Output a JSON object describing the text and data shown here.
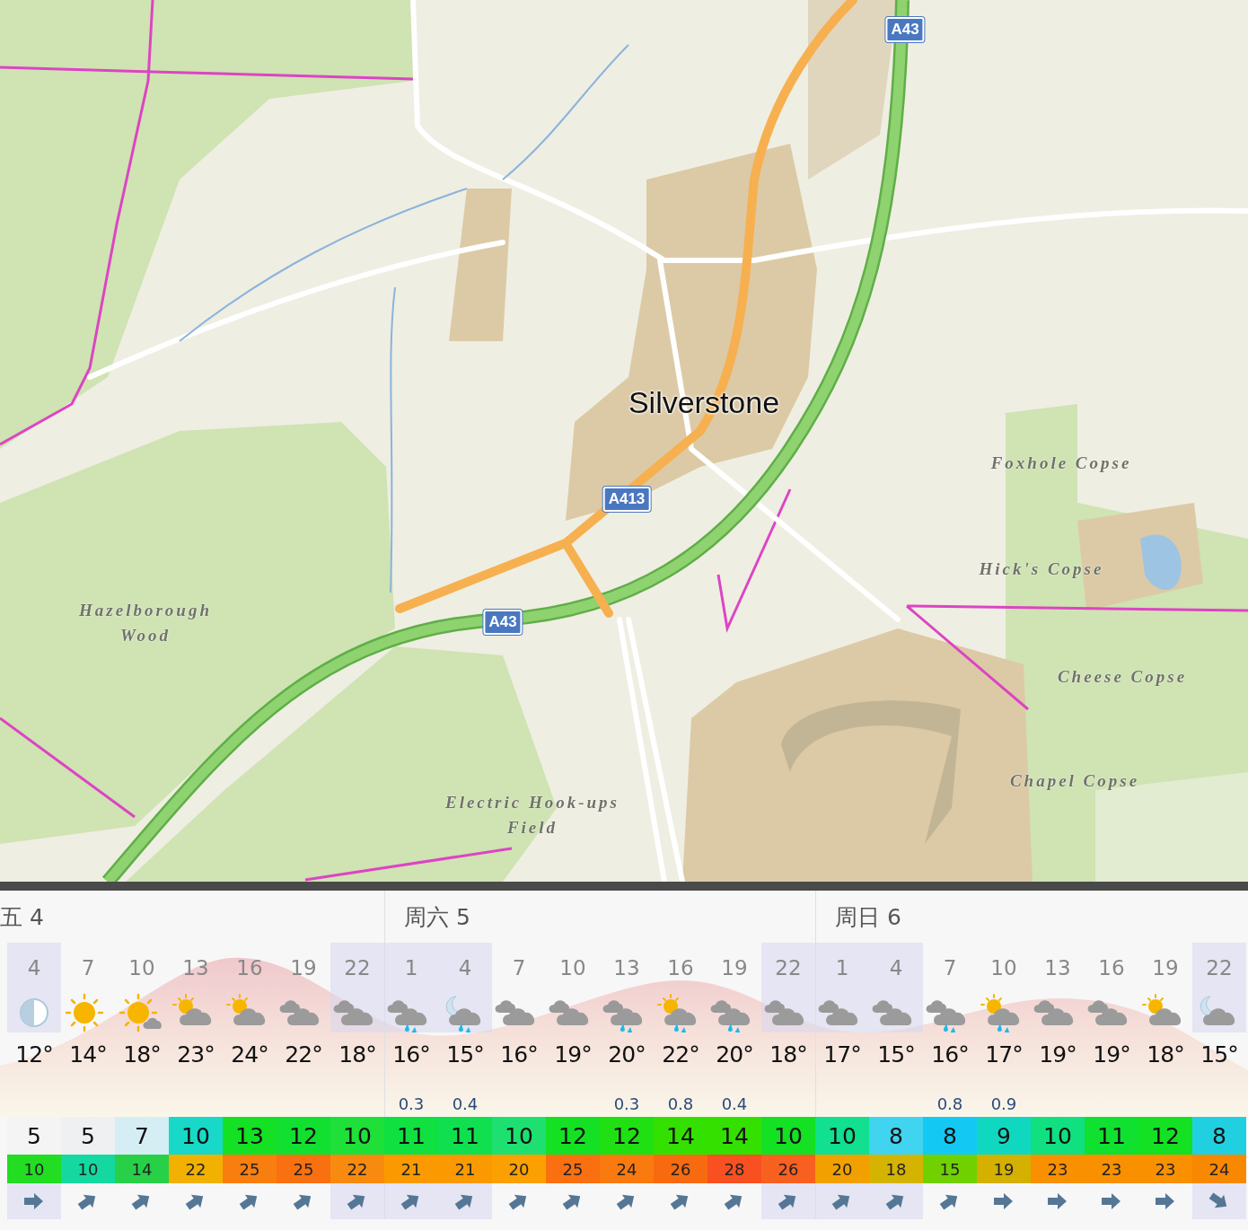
{
  "map": {
    "labels": [
      {
        "text": "A43",
        "kind": "road"
      },
      {
        "text": "Silverstone",
        "kind": "town"
      },
      {
        "text": "A413",
        "kind": "road"
      },
      {
        "text": "Foxhole Copse",
        "kind": "area"
      },
      {
        "text": "Hick's Copse",
        "kind": "area"
      },
      {
        "text": "Hazelborough Wood",
        "kind": "area"
      },
      {
        "text": "A43",
        "kind": "road"
      },
      {
        "text": "Cheese Copse",
        "kind": "area"
      },
      {
        "text": "Chapel Copse",
        "kind": "area"
      },
      {
        "text": "Electric Hook-ups Field",
        "kind": "area"
      }
    ]
  },
  "forecast": {
    "days": [
      {
        "label": "五 4",
        "hours": [
          {
            "hour": "4",
            "night": true,
            "kind": "half-moon",
            "temp": "12°"
          },
          {
            "hour": "7",
            "night": false,
            "kind": "sun",
            "temp": "14°"
          },
          {
            "hour": "10",
            "night": false,
            "kind": "sun-small-cloud",
            "temp": "18°"
          },
          {
            "hour": "13",
            "night": false,
            "kind": "partly-cloudy",
            "temp": "23°"
          },
          {
            "hour": "16",
            "night": false,
            "kind": "partly-cloudy",
            "temp": "24°"
          },
          {
            "hour": "19",
            "night": false,
            "kind": "cloudy",
            "temp": "22°"
          },
          {
            "hour": "22",
            "night": true,
            "kind": "cloudy",
            "temp": "18°"
          }
        ],
        "wind_speeds": [
          {
            "value": "5",
            "color": "#f4f4f4"
          },
          {
            "value": "5",
            "color": "#eef0f2"
          },
          {
            "value": "7",
            "color": "#d4eef4"
          },
          {
            "value": "10",
            "color": "#18d8c8"
          },
          {
            "value": "13",
            "color": "#14e024"
          },
          {
            "value": "12",
            "color": "#12e030"
          },
          {
            "value": "10",
            "color": "#1ee038"
          }
        ],
        "gusts": [
          {
            "value": "10",
            "color": "#22dd22"
          },
          {
            "value": "10",
            "color": "#14d8a0"
          },
          {
            "value": "14",
            "color": "#28d048"
          },
          {
            "value": "22",
            "color": "#f2b000"
          },
          {
            "value": "25",
            "color": "#f87e10"
          },
          {
            "value": "25",
            "color": "#f87010"
          },
          {
            "value": "22",
            "color": "#f88a10"
          }
        ],
        "wind_directions": [
          {
            "kind": "east"
          },
          {
            "kind": "northeast"
          },
          {
            "kind": "northeast"
          },
          {
            "kind": "northeast"
          },
          {
            "kind": "northeast"
          },
          {
            "kind": "northeast"
          },
          {
            "kind": "northeast"
          }
        ]
      },
      {
        "label": "周六 5",
        "hours": [
          {
            "hour": "1",
            "night": true,
            "kind": "rain",
            "temp": "16°",
            "precip": "0.3"
          },
          {
            "hour": "4",
            "night": true,
            "kind": "moon-rain",
            "temp": "15°",
            "precip": "0.4"
          },
          {
            "hour": "7",
            "night": false,
            "kind": "cloudy",
            "temp": "16°"
          },
          {
            "hour": "10",
            "night": false,
            "kind": "cloudy",
            "temp": "19°"
          },
          {
            "hour": "13",
            "night": false,
            "kind": "rain",
            "temp": "20°",
            "precip": "0.3"
          },
          {
            "hour": "16",
            "night": false,
            "kind": "sun-rain",
            "temp": "22°",
            "precip": "0.8"
          },
          {
            "hour": "19",
            "night": false,
            "kind": "rain",
            "temp": "20°",
            "precip": "0.4"
          },
          {
            "hour": "22",
            "night": true,
            "kind": "cloudy",
            "temp": "18°"
          }
        ],
        "wind_speeds": [
          {
            "value": "11",
            "color": "#10e040"
          },
          {
            "value": "11",
            "color": "#10e050"
          },
          {
            "value": "10",
            "color": "#1ee070"
          },
          {
            "value": "12",
            "color": "#14e024"
          },
          {
            "value": "12",
            "color": "#20e014"
          },
          {
            "value": "14",
            "color": "#34e000"
          },
          {
            "value": "14",
            "color": "#34e000"
          },
          {
            "value": "10",
            "color": "#14e024"
          }
        ],
        "gusts": [
          {
            "value": "21",
            "color": "#fa9a00"
          },
          {
            "value": "21",
            "color": "#fa9a00"
          },
          {
            "value": "20",
            "color": "#fba000"
          },
          {
            "value": "25",
            "color": "#fa7010"
          },
          {
            "value": "24",
            "color": "#fa7a10"
          },
          {
            "value": "26",
            "color": "#f86a10"
          },
          {
            "value": "28",
            "color": "#f85020"
          },
          {
            "value": "26",
            "color": "#f86020"
          }
        ],
        "wind_directions": [
          {
            "kind": "northeast"
          },
          {
            "kind": "northeast"
          },
          {
            "kind": "northeast"
          },
          {
            "kind": "northeast"
          },
          {
            "kind": "northeast"
          },
          {
            "kind": "northeast"
          },
          {
            "kind": "northeast"
          },
          {
            "kind": "northeast"
          }
        ]
      },
      {
        "label": "周日 6",
        "hours": [
          {
            "hour": "1",
            "night": true,
            "kind": "cloudy",
            "temp": "17°"
          },
          {
            "hour": "4",
            "night": true,
            "kind": "cloudy",
            "temp": "15°"
          },
          {
            "hour": "7",
            "night": false,
            "kind": "rain",
            "temp": "16°",
            "precip": "0.8"
          },
          {
            "hour": "10",
            "night": false,
            "kind": "sun-rain",
            "temp": "17°",
            "precip": "0.9"
          },
          {
            "hour": "13",
            "night": false,
            "kind": "cloudy",
            "temp": "19°"
          },
          {
            "hour": "16",
            "night": false,
            "kind": "cloudy",
            "temp": "19°"
          },
          {
            "hour": "19",
            "night": false,
            "kind": "partly-cloudy",
            "temp": "18°"
          },
          {
            "hour": "22",
            "night": true,
            "kind": "moon-cloud",
            "temp": "15°"
          }
        ],
        "wind_speeds": [
          {
            "value": "10",
            "color": "#10e090"
          },
          {
            "value": "8",
            "color": "#40d4f0"
          },
          {
            "value": "8",
            "color": "#14c8f4"
          },
          {
            "value": "9",
            "color": "#10d8c0"
          },
          {
            "value": "10",
            "color": "#10e080"
          },
          {
            "value": "11",
            "color": "#10e030"
          },
          {
            "value": "12",
            "color": "#14e024"
          },
          {
            "value": "8",
            "color": "#20d0e0"
          }
        ],
        "gusts": [
          {
            "value": "20",
            "color": "#f2a000"
          },
          {
            "value": "18",
            "color": "#d4b400"
          },
          {
            "value": "15",
            "color": "#70d000"
          },
          {
            "value": "19",
            "color": "#d4b000"
          },
          {
            "value": "23",
            "color": "#f89000"
          },
          {
            "value": "23",
            "color": "#f89000"
          },
          {
            "value": "23",
            "color": "#f89000"
          },
          {
            "value": "24",
            "color": "#f88800"
          }
        ],
        "wind_directions": [
          {
            "kind": "northeast"
          },
          {
            "kind": "northeast"
          },
          {
            "kind": "northeast"
          },
          {
            "kind": "east"
          },
          {
            "kind": "east"
          },
          {
            "kind": "east"
          },
          {
            "kind": "east"
          },
          {
            "kind": "southeast"
          }
        ]
      }
    ]
  }
}
